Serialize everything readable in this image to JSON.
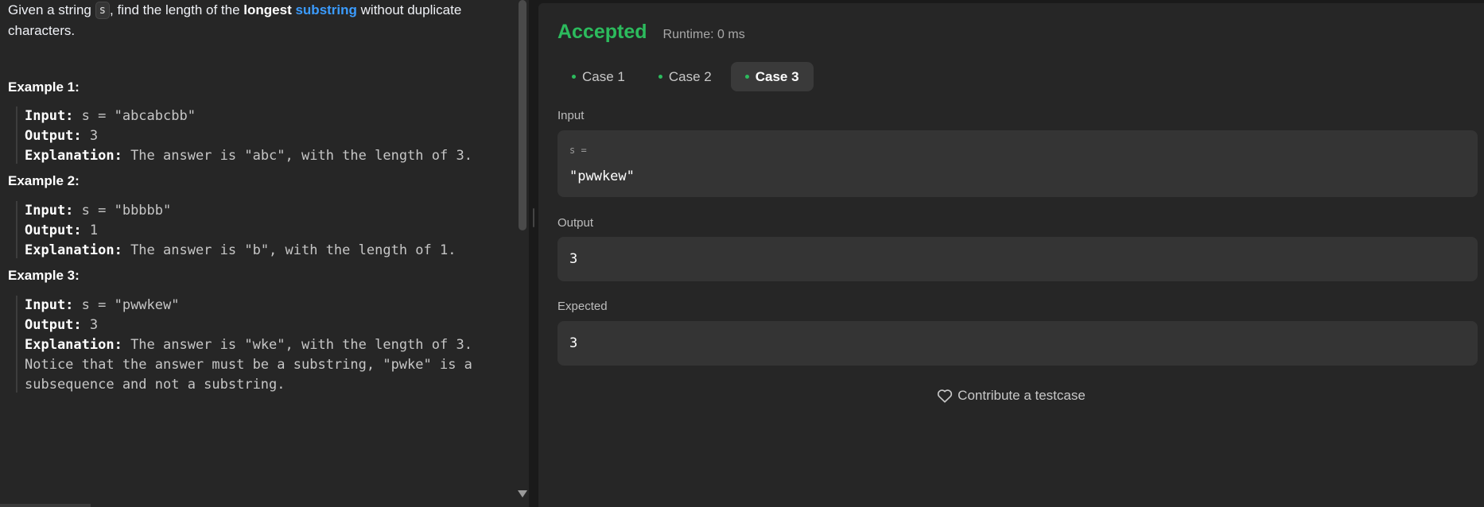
{
  "description": {
    "part1": "Given a string ",
    "code": "s",
    "part2": ", find the length of the ",
    "bold": "longest",
    "link": "substring",
    "part3": " without duplicate characters."
  },
  "examples": [
    {
      "title": "Example 1:",
      "input_key": "Input:",
      "input_val": " s = \"abcabcbb\"",
      "output_key": "Output:",
      "output_val": " 3",
      "expl_key": "Explanation:",
      "expl_val": " The answer is \"abc\", with the length of 3."
    },
    {
      "title": "Example 2:",
      "input_key": "Input:",
      "input_val": " s = \"bbbbb\"",
      "output_key": "Output:",
      "output_val": " 1",
      "expl_key": "Explanation:",
      "expl_val": " The answer is \"b\", with the length of 1."
    },
    {
      "title": "Example 3:",
      "input_key": "Input:",
      "input_val": " s = \"pwwkew\"",
      "output_key": "Output:",
      "output_val": " 3",
      "expl_key": "Explanation:",
      "expl_val": " The answer is \"wke\", with the length of 3.",
      "expl_line2": "Notice that the answer must be a substring, \"pwke\" is a",
      "expl_line3": "subsequence and not a substring."
    }
  ],
  "result": {
    "status": "Accepted",
    "runtime": "Runtime: 0 ms",
    "tabs": [
      "Case 1",
      "Case 2",
      "Case 3"
    ],
    "active_tab": "Case 3",
    "input_label": "Input",
    "input_var": "s =",
    "input_value": "\"pwwkew\"",
    "output_label": "Output",
    "output_value": "3",
    "expected_label": "Expected",
    "expected_value": "3",
    "contribute": "Contribute a testcase"
  },
  "colors": {
    "accepted": "#2cbb5d",
    "link": "#3b9cff",
    "panel_bg": "#262626",
    "page_bg": "#1a1a1a"
  }
}
